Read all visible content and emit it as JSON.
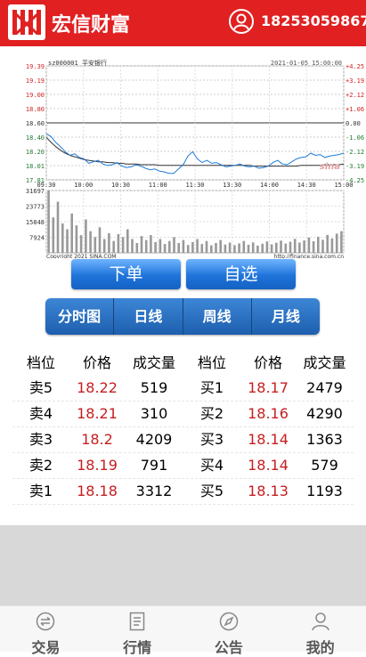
{
  "header": {
    "app_name": "宏信财富",
    "phone": "18253059867",
    "logo_icon": "hx-logo-icon",
    "user_icon": "user-circle-icon"
  },
  "chart": {
    "stock_code": "sz000001",
    "stock_name": "平安银行",
    "datetime": "2021-01-05 15:00:00",
    "left_ticks": [
      "19.39",
      "19.19",
      "19.00",
      "18.80",
      "18.60",
      "18.40",
      "18.20",
      "18.01",
      "17.81"
    ],
    "right_ticks": [
      "+4.25",
      "+3.19",
      "+2.12",
      "+1.06",
      "0.00",
      "-1.06",
      "-2.12",
      "-3.19",
      "-4.25"
    ],
    "time_ticks": [
      "09:30",
      "10:00",
      "10:30",
      "11:00",
      "11:30",
      "13:30",
      "14:00",
      "14:30",
      "15:00"
    ],
    "vol_ticks": [
      "31697",
      "23773",
      "15848",
      "7924"
    ],
    "copyright": "Copyright 2021 SINA.COM",
    "url": "http://finance.sina.com.cn",
    "watermark": "sina",
    "prev_close": 18.6,
    "y_range": [
      17.81,
      19.39
    ],
    "vol_max": 31697,
    "colors": {
      "price_line": "#1f7ad8",
      "avg_line": "#333333",
      "volume": "#999999",
      "up": "#d22222",
      "down": "#1f7a2e"
    },
    "price_series": [
      18.45,
      18.41,
      18.33,
      18.27,
      18.2,
      18.15,
      18.17,
      18.12,
      18.1,
      18.04,
      18.06,
      18.08,
      18.03,
      18.01,
      18.02,
      18.05,
      18.0,
      17.98,
      17.99,
      18.02,
      18.0,
      17.97,
      17.95,
      17.96,
      17.93,
      17.92,
      17.9,
      17.9,
      17.96,
      18.02,
      18.14,
      18.2,
      18.1,
      18.05,
      18.08,
      18.04,
      18.05,
      18.02,
      17.99,
      18.0,
      18.01,
      18.03,
      18.0,
      17.99,
      18.0,
      17.97,
      17.98,
      18.0,
      18.05,
      18.08,
      18.03,
      18.02,
      18.06,
      18.1,
      18.12,
      18.13,
      18.18,
      18.15,
      18.16,
      18.12,
      18.14,
      18.15,
      18.16,
      18.18
    ],
    "avg_series": [
      18.4,
      18.33,
      18.27,
      18.22,
      18.18,
      18.15,
      18.13,
      18.11,
      18.09,
      18.08,
      18.07,
      18.06,
      18.06,
      18.05,
      18.05,
      18.04,
      18.04,
      18.03,
      18.03,
      18.03,
      18.02,
      18.02,
      18.02,
      18.02,
      18.01,
      18.01,
      18.01,
      18.01,
      18.01,
      18.01,
      18.01,
      18.01,
      18.01,
      18.01,
      18.01,
      18.01,
      18.01,
      18.01,
      18.01,
      18.01,
      18.01,
      18.01,
      18.01,
      18.01,
      18.0,
      18.0,
      18.0,
      18.0,
      18.0,
      18.0,
      18.0,
      18.0,
      18.0,
      18.0,
      18.01,
      18.01,
      18.01,
      18.01,
      18.01,
      18.02,
      18.02,
      18.02,
      18.02,
      18.03
    ],
    "volume_series": [
      31697,
      18000,
      26000,
      15000,
      12000,
      20000,
      14000,
      9000,
      17000,
      11000,
      8000,
      13000,
      7000,
      10000,
      6000,
      9500,
      8000,
      12000,
      7000,
      5000,
      8500,
      6500,
      9000,
      5500,
      7000,
      4500,
      6000,
      8000,
      5000,
      6500,
      4000,
      5500,
      7000,
      4500,
      6000,
      3800,
      5000,
      6500,
      4200,
      5200,
      3900,
      4800,
      6000,
      4100,
      5300,
      3700,
      4600,
      5800,
      4300,
      5100,
      6200,
      4700,
      5600,
      7100,
      5200,
      6300,
      7800,
      5900,
      8200,
      6600,
      9100,
      7300,
      9800,
      11000
    ]
  },
  "buttons": {
    "order": "下单",
    "watchlist": "自选"
  },
  "tabs": [
    "分时图",
    "日线",
    "周线",
    "月线"
  ],
  "order_book": {
    "headers": [
      "档位",
      "价格",
      "成交量",
      "档位",
      "价格",
      "成交量"
    ],
    "rows": [
      {
        "sell_label": "卖5",
        "sell_price": "18.22",
        "sell_vol": "519",
        "buy_label": "买1",
        "buy_price": "18.17",
        "buy_vol": "2479"
      },
      {
        "sell_label": "卖4",
        "sell_price": "18.21",
        "sell_vol": "310",
        "buy_label": "买2",
        "buy_price": "18.16",
        "buy_vol": "4290"
      },
      {
        "sell_label": "卖3",
        "sell_price": "18.2",
        "sell_vol": "4209",
        "buy_label": "买3",
        "buy_price": "18.14",
        "buy_vol": "1363"
      },
      {
        "sell_label": "卖2",
        "sell_price": "18.19",
        "sell_vol": "791",
        "buy_label": "买4",
        "buy_price": "18.14",
        "buy_vol": "579"
      },
      {
        "sell_label": "卖1",
        "sell_price": "18.18",
        "sell_vol": "3312",
        "buy_label": "买5",
        "buy_price": "18.13",
        "buy_vol": "1193"
      }
    ]
  },
  "bottom_nav": [
    {
      "label": "交易",
      "icon": "exchange-arrows-icon"
    },
    {
      "label": "行情",
      "icon": "document-list-icon"
    },
    {
      "label": "公告",
      "icon": "compass-icon"
    },
    {
      "label": "我的",
      "icon": "user-icon"
    }
  ]
}
